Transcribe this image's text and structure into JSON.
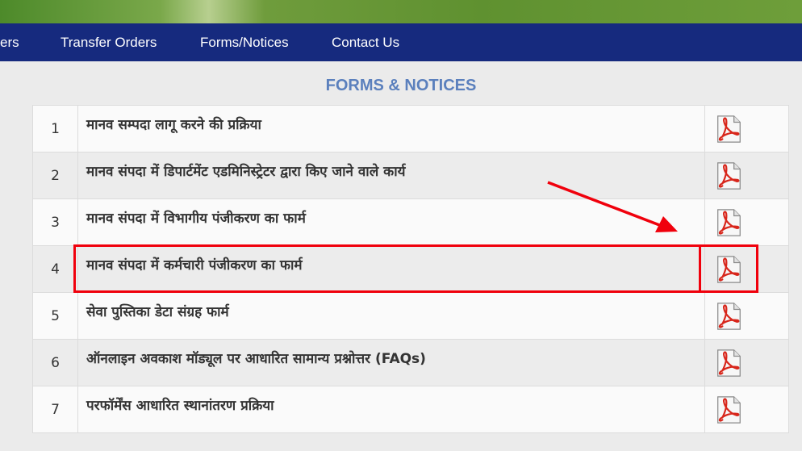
{
  "nav": {
    "items": [
      "ers",
      "Transfer Orders",
      "Forms/Notices",
      "Contact Us"
    ]
  },
  "section_title": "FORMS & NOTICES",
  "rows": [
    {
      "num": "1",
      "title": "मानव सम्पदा लागू करने की प्रक्रिया"
    },
    {
      "num": "2",
      "title": "मानव संपदा में डिपार्टमेंट एडमिनिस्ट्रेटर द्वारा किए जाने वाले कार्य"
    },
    {
      "num": "3",
      "title": "मानव संपदा में विभागीय पंजीकरण का फार्म"
    },
    {
      "num": "4",
      "title": "मानव संपदा में कर्मचारी पंजीकरण का फार्म"
    },
    {
      "num": "5",
      "title": "सेवा पुस्तिका डेटा संग्रह फार्म"
    },
    {
      "num": "6",
      "title": "ऑनलाइन अवकाश मॉड्यूल पर आधारित सामान्य प्रश्नोत्तर (FAQs)"
    },
    {
      "num": "7",
      "title": "परफॉर्मेंस आधारित स्थानांतरण प्रक्रिया"
    }
  ],
  "icons": {
    "download": "pdf-icon"
  },
  "colors": {
    "navbar": "#162a7e",
    "top_strip": "#5f9130",
    "title": "#5b80bd",
    "annotation": "#f0000c"
  }
}
